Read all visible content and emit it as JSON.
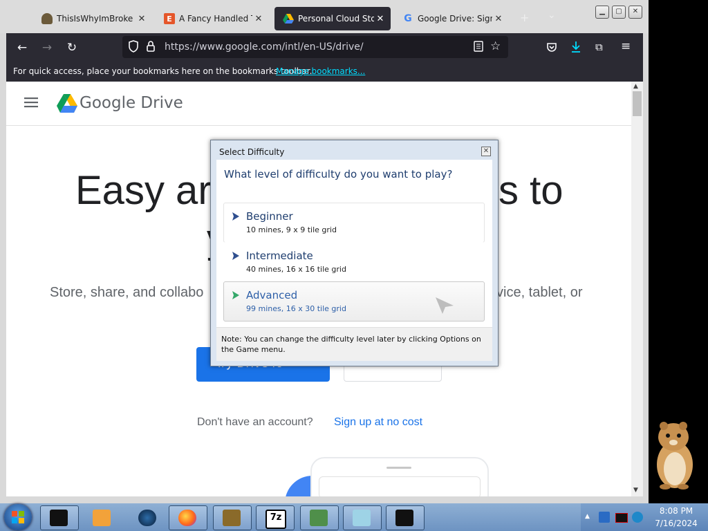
{
  "browser": {
    "tabs": [
      {
        "label": "ThisIsWhyImBroke :: T",
        "icon": "mushroom-favicon-icon",
        "active": false
      },
      {
        "label": "A Fancy Handled Tact",
        "icon": "etsy-favicon-icon",
        "active": false
      },
      {
        "label": "Personal Cloud Storag",
        "icon": "google-drive-favicon-icon",
        "active": true
      },
      {
        "label": "Google Drive: Sign-in",
        "icon": "google-favicon-icon",
        "active": false
      }
    ],
    "new_tab_label": "+",
    "tab_list_label": "⌄",
    "url": "https://www.google.com/intl/en-US/drive/",
    "bookmarks_message": "For quick access, place your bookmarks here on the bookmarks toolbar.",
    "bookmarks_link": "Manage bookmarks..."
  },
  "page": {
    "logo_text": "Google Drive",
    "headline_left": "Easy ar",
    "headline_right": "s to",
    "headline_line2": "y",
    "subtext_left": "Store, share, and collabo",
    "subtext_right": "vice, tablet, or",
    "primary_button": "Try Drive fo",
    "no_account_text": "Don't have an account?",
    "signup_link": "Sign up at no cost"
  },
  "dialog": {
    "title": "Select Difficulty",
    "question": "What level of difficulty do you want to play?",
    "options": [
      {
        "title": "Beginner",
        "subtitle": "10 mines, 9 x 9 tile grid"
      },
      {
        "title": "Intermediate",
        "subtitle": "40 mines, 16 x 16 tile grid"
      },
      {
        "title": "Advanced",
        "subtitle": "99 mines, 16 x 30 tile grid"
      }
    ],
    "note": "Note: You can change the difficulty level later by clicking Options on the Game menu."
  },
  "taskbar": {
    "buttons": [
      "terminal-app-icon",
      "media-player-icon",
      "browser-globe-icon",
      "firefox-icon",
      "box-game-icon",
      "7zip-icon",
      "scanner-icon",
      "notepad-icon",
      "console-icon"
    ],
    "clock_time": "8:08 PM",
    "clock_date": "7/16/2024"
  },
  "colors": {
    "accent": "#1a73e8",
    "dialog_heading": "#1e3d6e",
    "link": "#0060df"
  }
}
